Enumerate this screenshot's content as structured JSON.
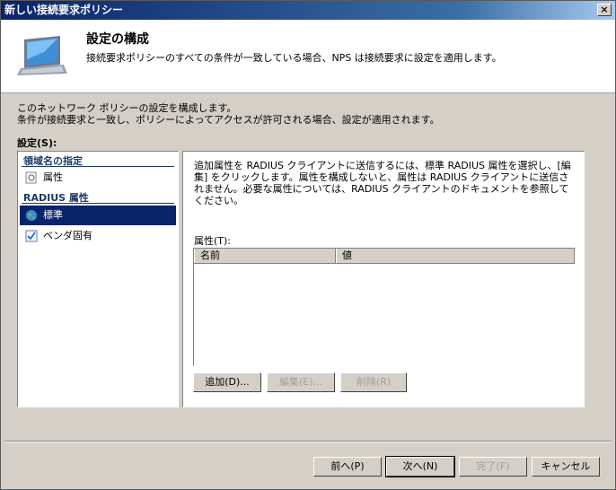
{
  "window": {
    "title": "新しい接続要求ポリシー",
    "close_label": "×"
  },
  "header": {
    "title": "設定の構成",
    "subtitle": "接続要求ポリシーのすべての条件が一致している場合、NPS は接続要求に設定を適用します。"
  },
  "intro": {
    "line1": "このネットワーク ポリシーの設定を構成します。",
    "line2": "条件が接続要求と一致し、ポリシーによってアクセスが許可される場合、設定が適用されます。"
  },
  "settings_label": "設定(S):",
  "nav": {
    "section1": "領域名の指定",
    "item_attributes": "属性",
    "section2": "RADIUS 属性",
    "item_standard": "標準",
    "item_vendor": "ベンダ固有"
  },
  "detail": {
    "description": "追加属性を RADIUS クライアントに送信するには、標準 RADIUS 属性を選択し、[編集] をクリックします。属性を構成しないと、属性は RADIUS クライアントに送信されません。必要な属性については、RADIUS クライアントのドキュメントを参照してください。",
    "attr_label": "属性(T):",
    "columns": [
      "名前",
      "値"
    ],
    "add_button": "追加(D)...",
    "edit_button": "編集(E)...",
    "delete_button": "削除(R)"
  },
  "footer": {
    "back": "前へ(P)",
    "next": "次へ(N)",
    "finish": "完了(F)",
    "cancel": "キャンセル"
  }
}
